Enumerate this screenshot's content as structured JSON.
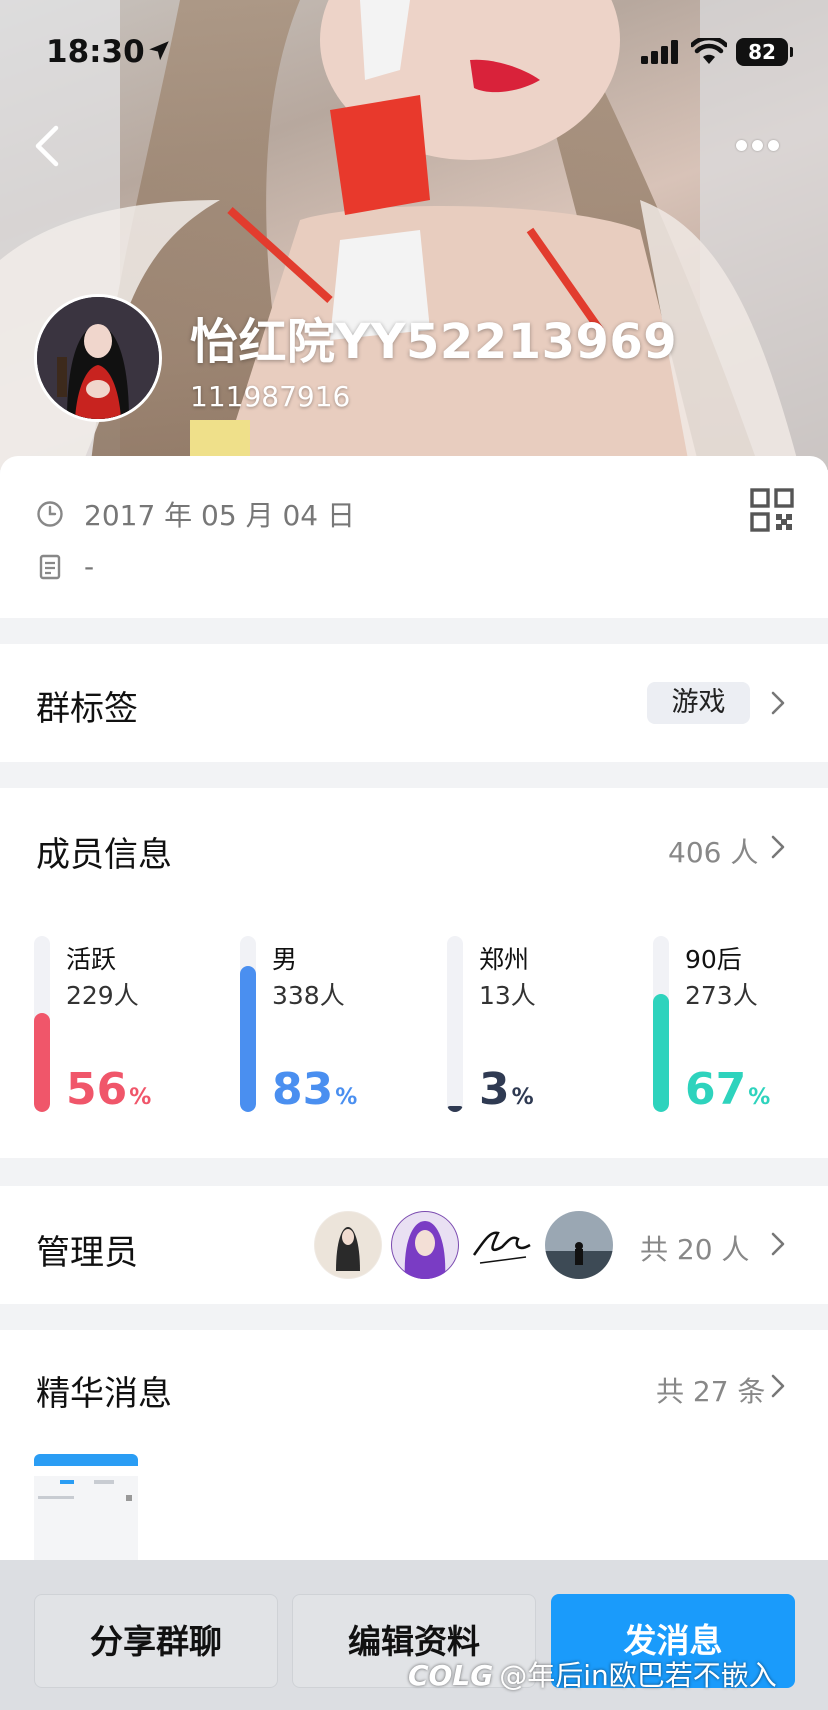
{
  "status_bar": {
    "time": "18:30",
    "battery": "82"
  },
  "header": {
    "group_name": "怡红院YY52213969",
    "group_id": "111987916"
  },
  "info": {
    "created_date": "2017 年 05 月 04 日",
    "description": "-"
  },
  "tag_section": {
    "title": "群标签",
    "tag": "游戏"
  },
  "members": {
    "title": "成员信息",
    "total": "406 人",
    "stats": [
      {
        "label": "活跃",
        "count": "229人",
        "percent": "56",
        "unit": "%",
        "fraction": 0.56,
        "color": "#f0566a"
      },
      {
        "label": "男",
        "count": "338人",
        "percent": "83",
        "unit": "%",
        "fraction": 0.83,
        "color": "#4a8ff0"
      },
      {
        "label": "郑州",
        "count": "13人",
        "percent": "3",
        "unit": "%",
        "fraction": 0.03,
        "color": "#2f3a52"
      },
      {
        "label": "90后",
        "count": "273人",
        "percent": "67",
        "unit": "%",
        "fraction": 0.67,
        "color": "#2ed3bd"
      }
    ]
  },
  "admins": {
    "title": "管理员",
    "total": "共 20 人"
  },
  "essence": {
    "title": "精华消息",
    "total": "共 27 条"
  },
  "bottom_bar": {
    "share": "分享群聊",
    "edit": "编辑资料",
    "send": "发消息"
  },
  "watermark": {
    "logo": "COLG",
    "text": "@年后in欧巴若不嵌入"
  }
}
